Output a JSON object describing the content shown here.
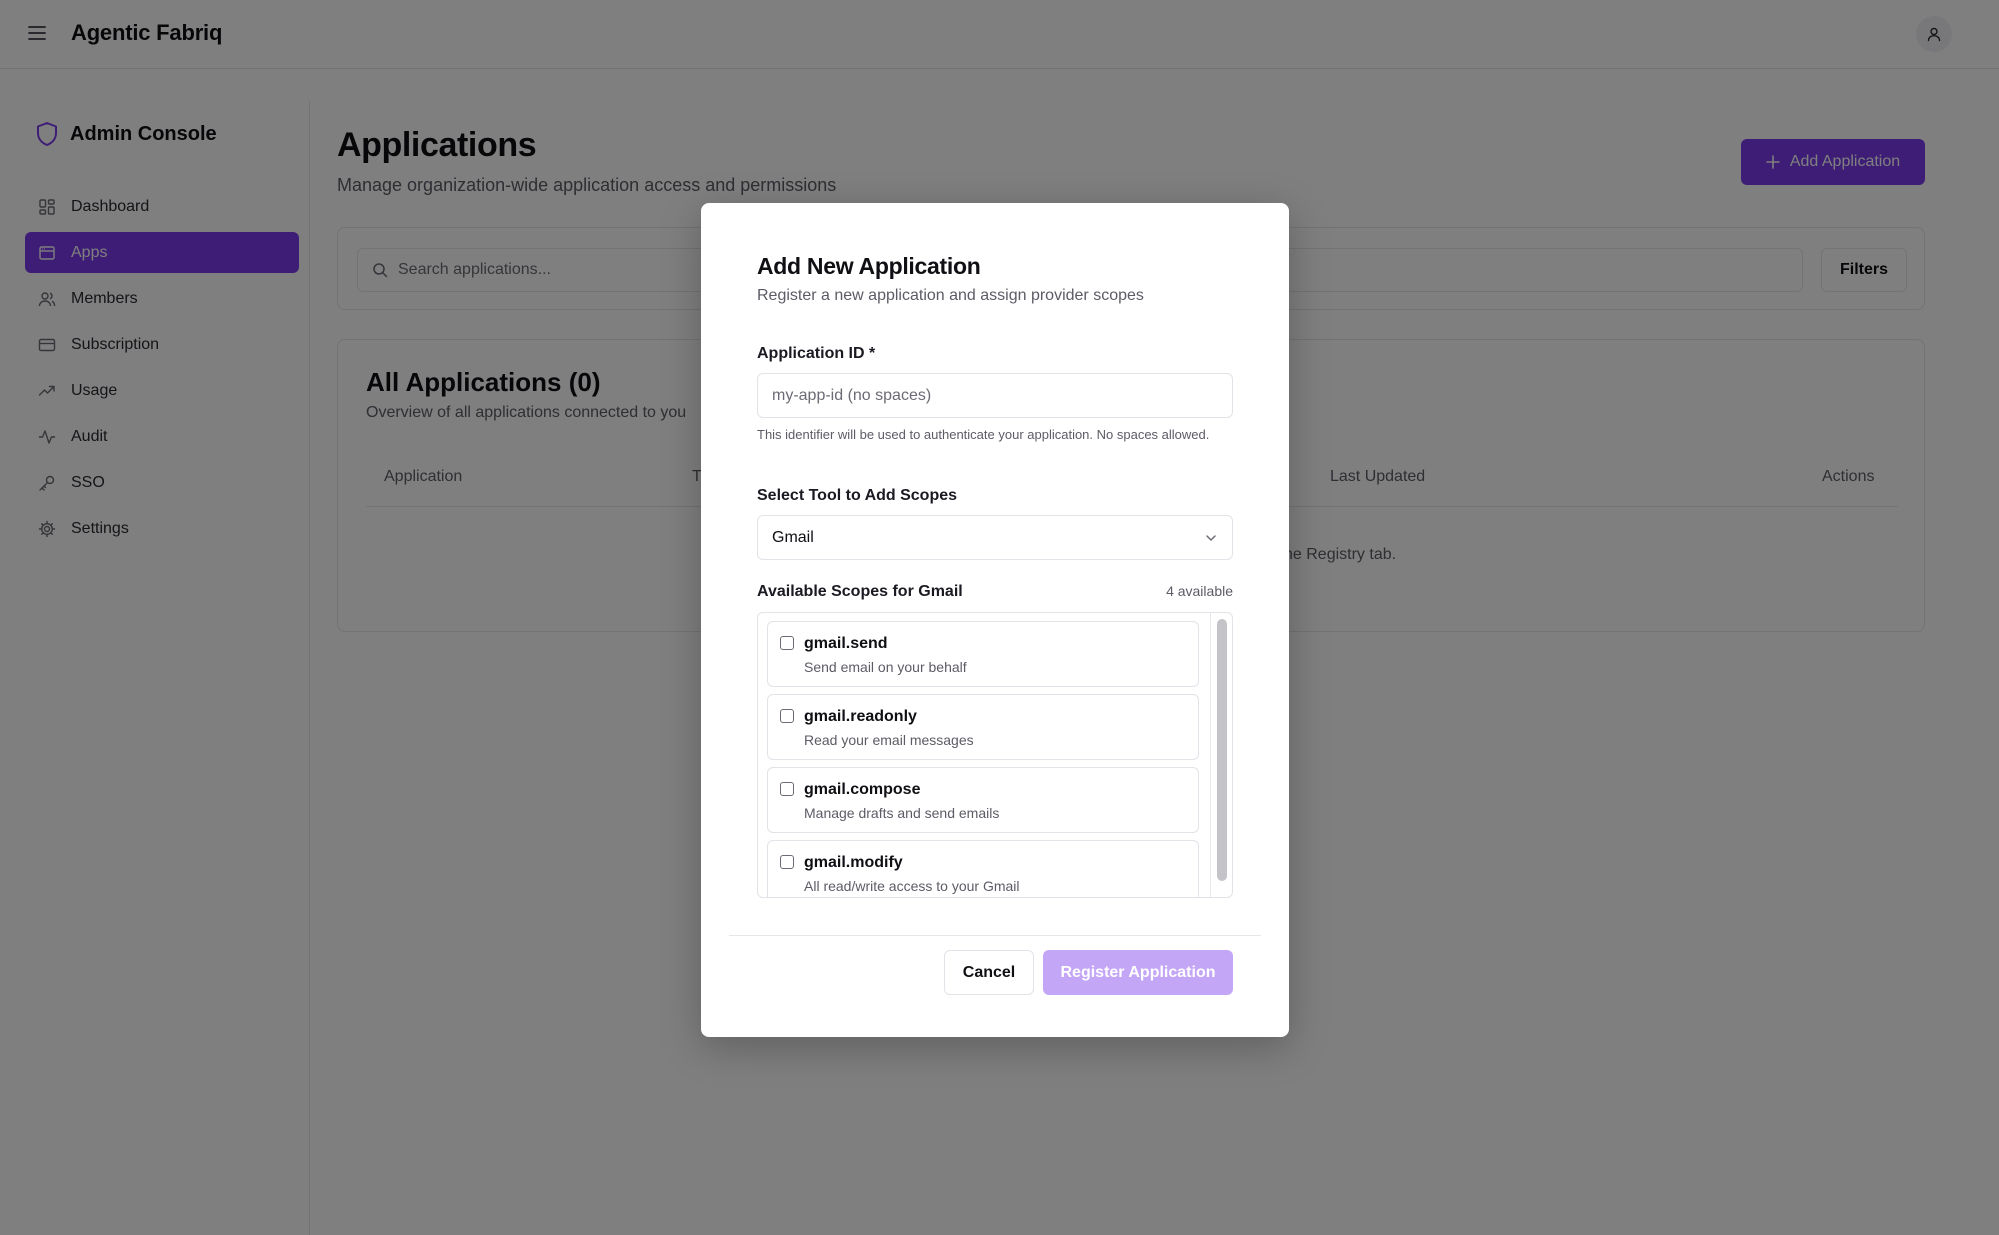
{
  "topbar": {
    "title": "Agentic Fabriq",
    "menu_icon": "hamburger-icon",
    "avatar_icon": "user-icon"
  },
  "sidebar": {
    "title": "Admin Console",
    "items": [
      {
        "label": "Dashboard",
        "icon": "dashboard-icon"
      },
      {
        "label": "Apps",
        "icon": "apps-icon",
        "active": true
      },
      {
        "label": "Members",
        "icon": "members-icon"
      },
      {
        "label": "Subscription",
        "icon": "card-icon"
      },
      {
        "label": "Usage",
        "icon": "trend-icon"
      },
      {
        "label": "Audit",
        "icon": "activity-icon"
      },
      {
        "label": "SSO",
        "icon": "key-icon"
      },
      {
        "label": "Settings",
        "icon": "gear-icon"
      }
    ]
  },
  "main": {
    "title": "Applications",
    "subtitle": "Manage organization-wide application access and permissions",
    "add_button": "Add Application",
    "search": {
      "placeholder": "Search applications..."
    },
    "filters_button": "Filters",
    "card": {
      "title": "All Applications (0)",
      "subtitle": "Overview of all applications connected to you",
      "columns": [
        "Application",
        "T",
        "Last Updated",
        "Actions"
      ],
      "empty_message": "he Registry tab."
    }
  },
  "modal": {
    "title": "Add New Application",
    "subtitle": "Register a new application and assign provider scopes",
    "app_id_label": "Application ID *",
    "app_id_placeholder": "my-app-id (no spaces)",
    "app_id_hint": "This identifier will be used to authenticate your application. No spaces allowed.",
    "tool_label": "Select Tool to Add Scopes",
    "tool_selected": "Gmail",
    "scopes_label": "Available Scopes for Gmail",
    "scopes_count": "4 available",
    "scopes": [
      {
        "name": "gmail.send",
        "description": "Send email on your behalf"
      },
      {
        "name": "gmail.readonly",
        "description": "Read your email messages"
      },
      {
        "name": "gmail.compose",
        "description": "Manage drafts and send emails"
      },
      {
        "name": "gmail.modify",
        "description": "All read/write access to your Gmail"
      }
    ],
    "cancel_button": "Cancel",
    "register_button": "Register Application"
  },
  "colors": {
    "accent": "#7c3aed",
    "accent_disabled": "#c4a6f7",
    "overlay": "rgba(0,0,0,0.5)"
  }
}
